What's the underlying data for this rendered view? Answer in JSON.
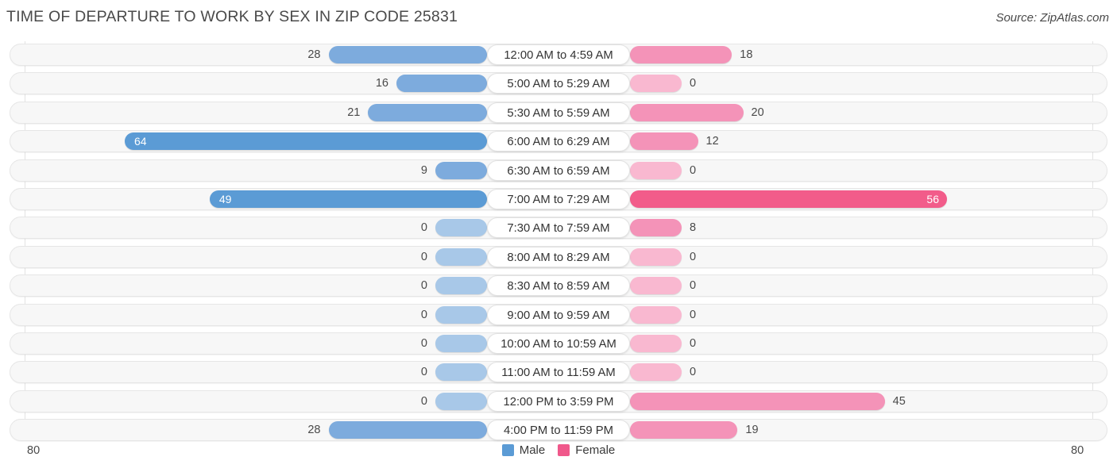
{
  "header": {
    "title": "TIME OF DEPARTURE TO WORK BY SEX IN ZIP CODE 25831",
    "source": "Source: ZipAtlas.com"
  },
  "axis": {
    "left_max_label": "80",
    "right_max_label": "80",
    "max": 80
  },
  "legend": {
    "items": [
      {
        "label": "Male",
        "color": "#5B9BD5"
      },
      {
        "label": "Female",
        "color": "#F0588B"
      }
    ]
  },
  "colors": {
    "male_normal": "#7DABDD",
    "male_strong": "#5B9BD5",
    "male_zero": "#A8C8E8",
    "female_normal": "#F493B8",
    "female_strong": "#F25C8A",
    "female_zero": "#F9B8D0",
    "track_bg": "#f7f7f7",
    "track_border": "#e6e6e6",
    "gridline": "#e3e3e3"
  },
  "chart_data": {
    "type": "bar",
    "title": "TIME OF DEPARTURE TO WORK BY SEX IN ZIP CODE 25831",
    "subtitle": "",
    "xlabel": "",
    "ylabel": "",
    "orientation": "horizontal-diverging",
    "xlim": [
      0,
      80
    ],
    "grid": true,
    "legend_position": "bottom-center",
    "categories": [
      "12:00 AM to 4:59 AM",
      "5:00 AM to 5:29 AM",
      "5:30 AM to 5:59 AM",
      "6:00 AM to 6:29 AM",
      "6:30 AM to 6:59 AM",
      "7:00 AM to 7:29 AM",
      "7:30 AM to 7:59 AM",
      "8:00 AM to 8:29 AM",
      "8:30 AM to 8:59 AM",
      "9:00 AM to 9:59 AM",
      "10:00 AM to 10:59 AM",
      "11:00 AM to 11:59 AM",
      "12:00 PM to 3:59 PM",
      "4:00 PM to 11:59 PM"
    ],
    "series": [
      {
        "name": "Male",
        "values": [
          28,
          16,
          21,
          64,
          9,
          49,
          0,
          0,
          0,
          0,
          0,
          0,
          0,
          28
        ]
      },
      {
        "name": "Female",
        "values": [
          18,
          0,
          20,
          12,
          0,
          56,
          8,
          0,
          0,
          0,
          0,
          0,
          45,
          19
        ]
      }
    ]
  }
}
